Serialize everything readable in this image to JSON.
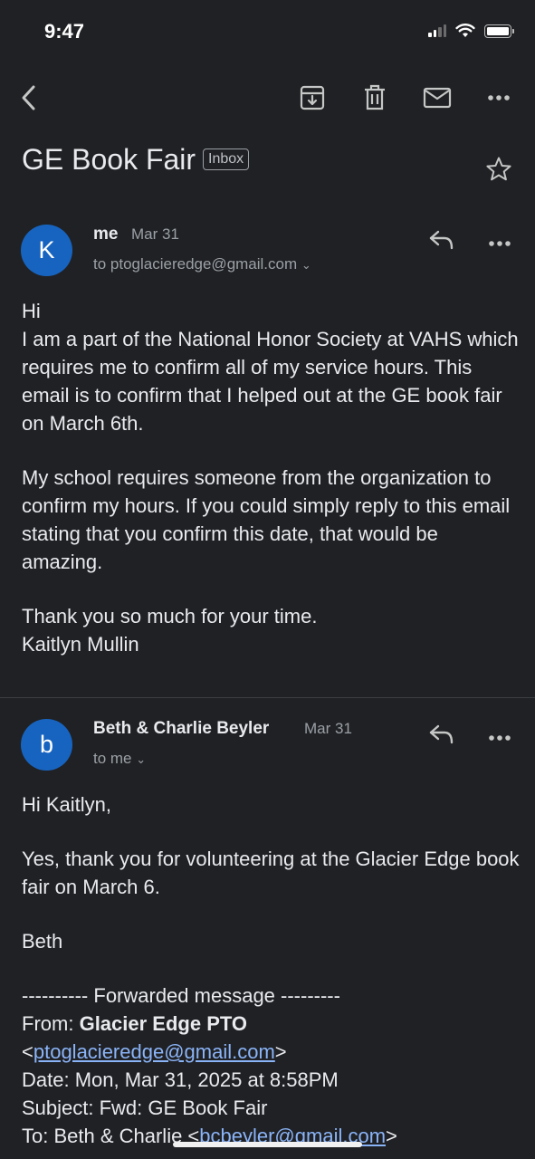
{
  "status": {
    "time": "9:47"
  },
  "toolbar": {
    "back": "back-arrow-icon",
    "archive": "archive-icon",
    "delete": "trash-icon",
    "mark_unread": "mail-icon",
    "more": "more-horizontal-icon"
  },
  "thread": {
    "subject": "GE Book Fair",
    "label": "Inbox"
  },
  "messages": [
    {
      "avatar_letter": "K",
      "avatar_color": "#1764c0",
      "sender": "me",
      "date": "Mar 31",
      "recipient": "to ptoglacieredge@gmail.com",
      "body": [
        "Hi",
        "I am a part of the National Honor Society at VAHS which requires me to confirm all of my service hours. This email is to confirm that I helped out at the GE book fair on March 6th.",
        "My school requires someone from the organization to confirm my hours. If you could simply reply to this email stating that you confirm this date, that would be amazing.",
        "Thank you so much for your time.",
        "Kaitlyn Mullin"
      ]
    },
    {
      "avatar_letter": "b",
      "avatar_color": "#1764c0",
      "sender": "Beth & Charlie Beyler",
      "date": "Mar 31",
      "recipient": "to me",
      "body": [
        "Hi Kaitlyn,",
        "Yes, thank you for volunteering at the Glacier Edge book fair on March 6.",
        "Beth",
        "---------- Forwarded message ---------"
      ],
      "forward": {
        "from_label": "From:",
        "from_name": "Glacier Edge PTO",
        "from_email": "ptoglacieredge@gmail.com",
        "date_line": "Date: Mon, Mar 31, 2025 at 8:58PM",
        "subject_line": "Subject: Fwd: GE Book Fair",
        "to_label": "To: Beth & Charlie <",
        "to_email": "bcbeyler@gmail.com"
      }
    }
  ]
}
